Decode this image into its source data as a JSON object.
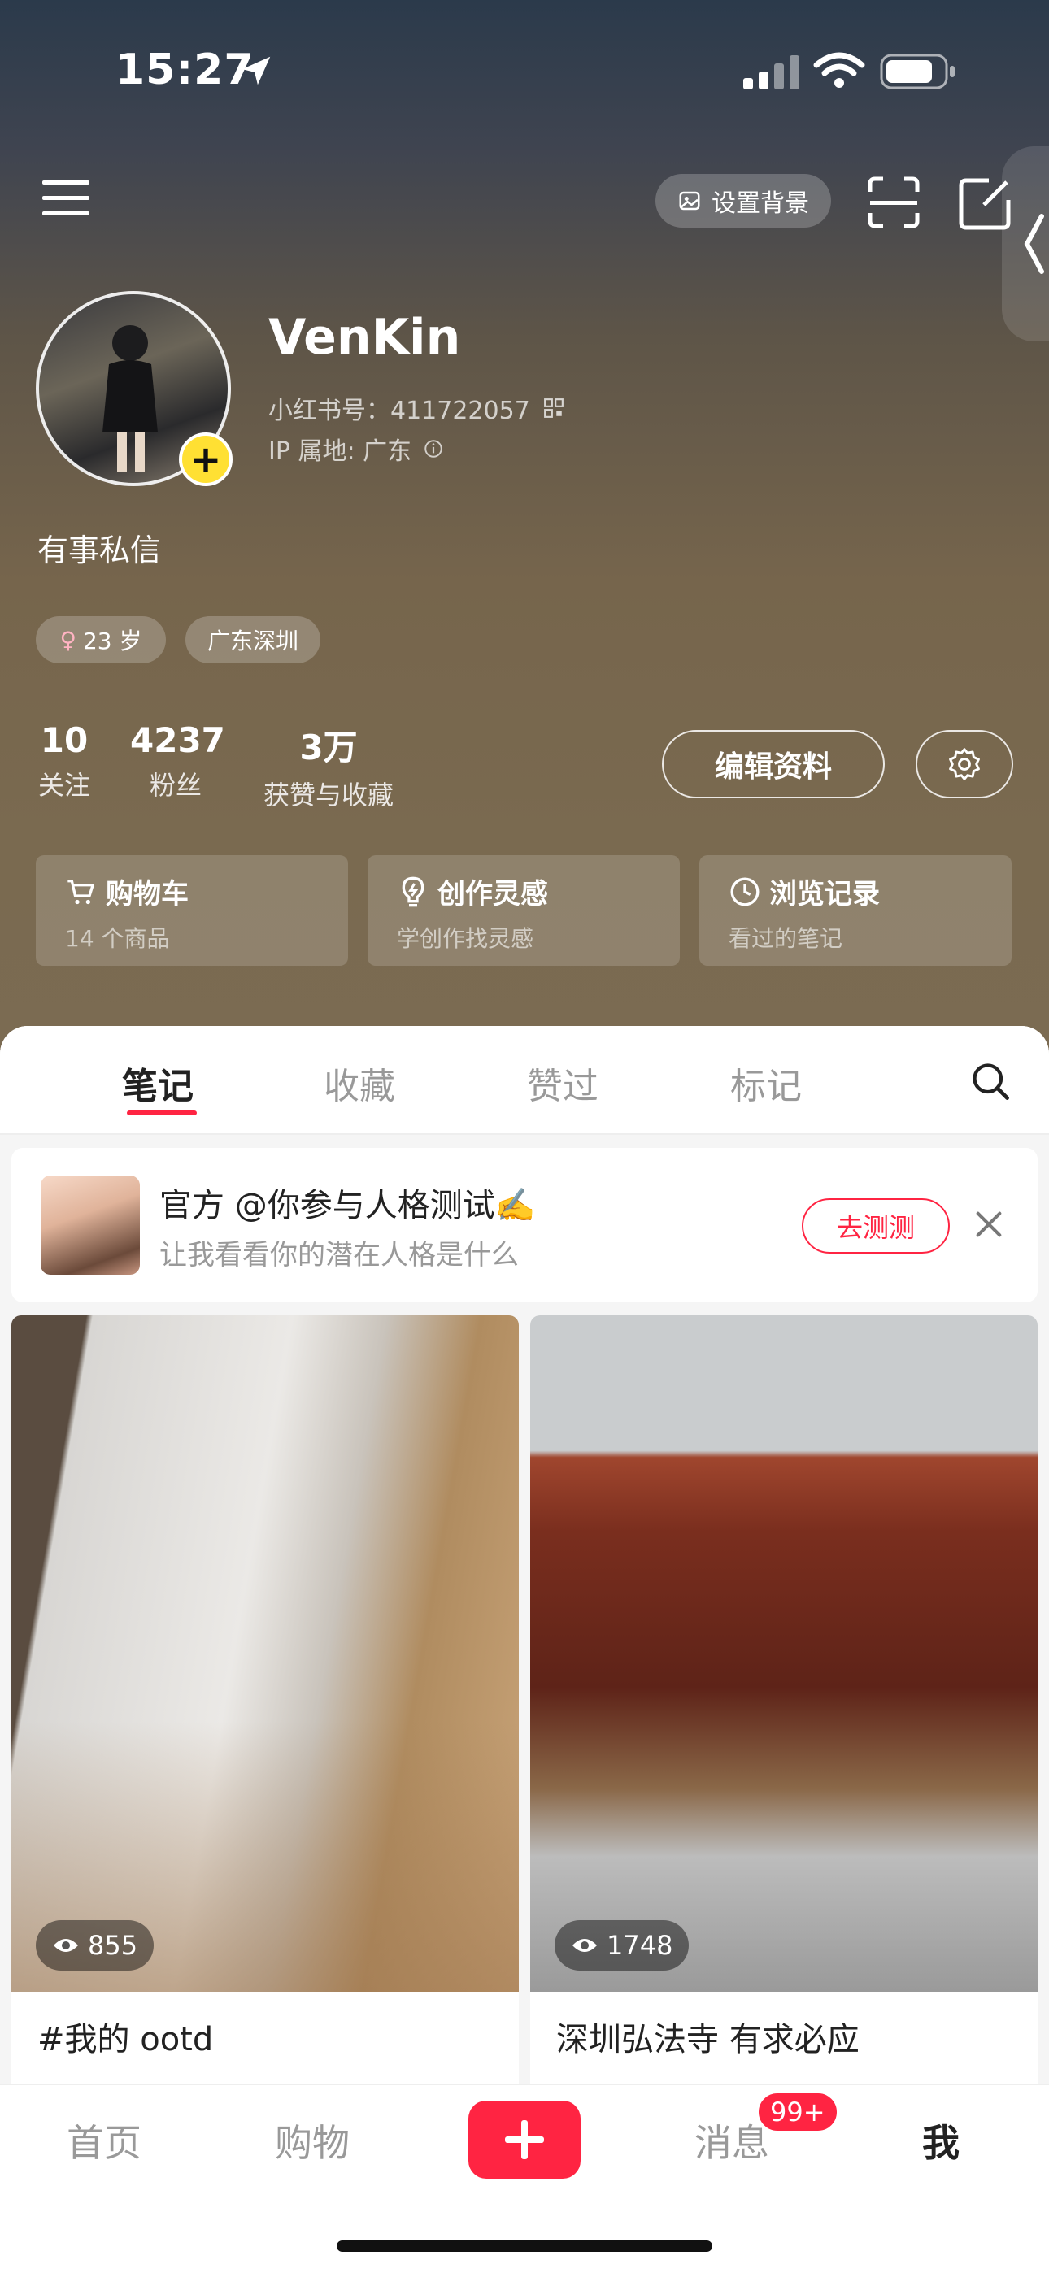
{
  "status_bar": {
    "time": "15:27"
  },
  "top_nav": {
    "set_background_label": "设置背景"
  },
  "profile": {
    "username": "VenKin",
    "xhs_id_label": "小红书号：411722057",
    "ip_label": "IP 属地: 广东",
    "bio": "有事私信",
    "tags": {
      "age": "23 岁",
      "location": "广东深圳"
    }
  },
  "stats": [
    {
      "num": "10",
      "label": "关注"
    },
    {
      "num": "4237",
      "label": "粉丝"
    },
    {
      "num": "3万",
      "label": "获赞与收藏"
    }
  ],
  "actions": {
    "edit_profile": "编辑资料"
  },
  "cards": [
    {
      "title": "购物车",
      "sub": "14 个商品",
      "icon": "cart-icon"
    },
    {
      "title": "创作灵感",
      "sub": "学创作找灵感",
      "icon": "lightbulb-icon"
    },
    {
      "title": "浏览记录",
      "sub": "看过的笔记",
      "icon": "clock-icon"
    }
  ],
  "tabs": [
    "笔记",
    "收藏",
    "赞过",
    "标记"
  ],
  "active_tab": "笔记",
  "promo": {
    "title": "官方 @你参与人格测试✍️",
    "subtitle": "让我看看你的潜在人格是什么",
    "button": "去测测"
  },
  "feed": [
    {
      "views": "855",
      "title": "#我的 ootd"
    },
    {
      "views": "1748",
      "title": "深圳弘法寺 有求必应"
    }
  ],
  "bottom_nav": {
    "home": "首页",
    "shop": "购物",
    "messages": "消息",
    "messages_badge": "99+",
    "me": "我"
  },
  "colors": {
    "accent": "#ff2442",
    "avatar_badge": "#ffe033"
  }
}
